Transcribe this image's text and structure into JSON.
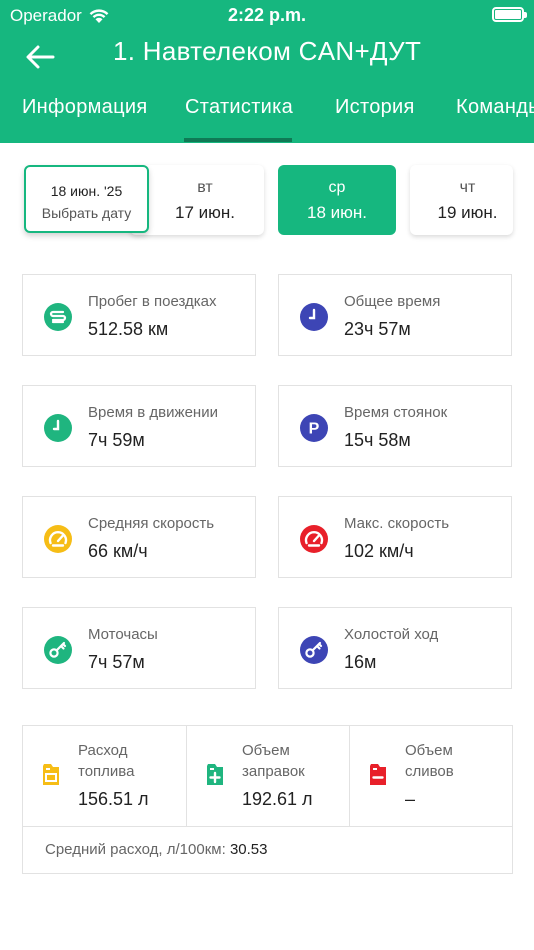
{
  "status_bar": {
    "carrier": "Operador",
    "time": "2:22 p.m."
  },
  "header": {
    "title": "1. Навтелеком CAN+ДУТ",
    "back_icon": "arrow-left-icon"
  },
  "tabs": [
    {
      "label": "Информация",
      "selected": false
    },
    {
      "label": "Статистика",
      "selected": true
    },
    {
      "label": "История",
      "selected": false
    },
    {
      "label": "Команды",
      "selected": false
    }
  ],
  "date_picker": {
    "date": "18 июн. '25",
    "action": "Выбрать дату"
  },
  "days": [
    {
      "weekday": "вт",
      "date": "17 июн.",
      "selected": false
    },
    {
      "weekday": "ср",
      "date": "18 июн.",
      "selected": true
    },
    {
      "weekday": "чт",
      "date": "19 июн.",
      "selected": false
    }
  ],
  "stats": [
    {
      "label": "Пробег в поездках",
      "value": "512.58 км",
      "icon": "road-icon",
      "color": "#1fb57f"
    },
    {
      "label": "Общее время",
      "value": "23ч 57м",
      "icon": "clock-icon",
      "color": "#3d45b5"
    },
    {
      "label": "Время в движении",
      "value": "7ч 59м",
      "icon": "clock-icon",
      "color": "#1fb57f"
    },
    {
      "label": "Время стоянок",
      "value": "15ч 58м",
      "icon": "parking-icon",
      "color": "#3d45b5"
    },
    {
      "label": "Средняя скорость",
      "value": "66 км/ч",
      "icon": "speedometer-icon",
      "color": "#f6bd16"
    },
    {
      "label": "Макс. скорость",
      "value": "102 км/ч",
      "icon": "speedometer-icon",
      "color": "#e8202a"
    },
    {
      "label": "Моточасы",
      "value": "7ч 57м",
      "icon": "engine-key-icon",
      "color": "#1fb57f"
    },
    {
      "label": "Холостой ход",
      "value": "16м",
      "icon": "engine-key-icon",
      "color": "#3d45b5"
    }
  ],
  "fuel": {
    "items": [
      {
        "label": "Расход топлива",
        "value": "156.51 л",
        "icon": "fuel-canister-icon",
        "color": "#f6bd16"
      },
      {
        "label": "Объем заправок",
        "value": "192.61 л",
        "icon": "fuel-canister-plus-icon",
        "color": "#1fb57f"
      },
      {
        "label": "Объем сливов",
        "value": "–",
        "icon": "fuel-canister-minus-icon",
        "color": "#e8202a"
      }
    ],
    "avg_label": "Средний расход, л/100км:",
    "avg_value": "30.53"
  },
  "colors": {
    "primary": "#16b77f",
    "tab_indicator": "#0f7a55",
    "blue": "#3d45b5",
    "yellow": "#f6bd16",
    "red": "#e8202a"
  }
}
